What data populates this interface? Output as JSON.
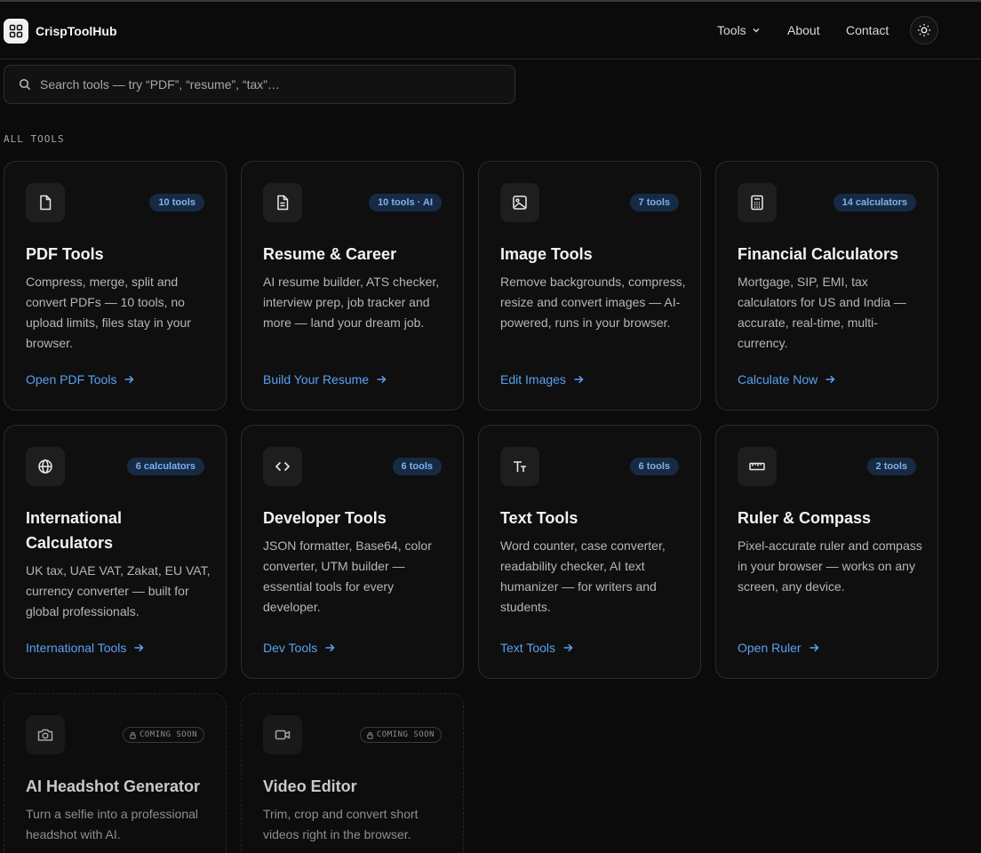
{
  "brand": {
    "name": "CrispToolHub"
  },
  "nav": {
    "tools": "Tools",
    "about": "About",
    "contact": "Contact"
  },
  "search": {
    "placeholder": "Search tools — try “PDF”, “resume”, “tax”…"
  },
  "section_label": "ALL TOOLS",
  "cards": [
    {
      "title": "PDF Tools",
      "badge": "10 tools",
      "icon": "file-icon",
      "desc": "Compress, merge, split and convert PDFs — 10 tools, no upload limits, files stay in your browser.",
      "link": "Open PDF Tools"
    },
    {
      "title": "Resume & Career",
      "badge": "10 tools · AI",
      "icon": "document-icon",
      "desc": "AI resume builder, ATS checker, interview prep, job tracker and more — land your dream job.",
      "link": "Build Your Resume"
    },
    {
      "title": "Image Tools",
      "badge": "7 tools",
      "icon": "image-icon",
      "desc": "Remove backgrounds, compress, resize and convert images — AI-powered, runs in your browser.",
      "link": "Edit Images"
    },
    {
      "title": "Financial Calculators",
      "badge": "14 calculators",
      "icon": "calculator-icon",
      "desc": "Mortgage, SIP, EMI, tax calculators for US and India — accurate, real-time, multi-currency.",
      "link": "Calculate Now"
    },
    {
      "title": "International Calculators",
      "badge": "6 calculators",
      "icon": "globe-icon",
      "desc": "UK tax, UAE VAT, Zakat, EU VAT, currency converter — built for global professionals.",
      "link": "International Tools"
    },
    {
      "title": "Developer Tools",
      "badge": "6 tools",
      "icon": "code-icon",
      "desc": "JSON formatter, Base64, color converter, UTM builder — essential tools for every developer.",
      "link": "Dev Tools"
    },
    {
      "title": "Text Tools",
      "badge": "6 tools",
      "icon": "text-icon",
      "desc": "Word counter, case converter, readability checker, AI text humanizer — for writers and students.",
      "link": "Text Tools"
    },
    {
      "title": "Ruler & Compass",
      "badge": "2 tools",
      "icon": "ruler-icon",
      "desc": "Pixel-accurate ruler and compass in your browser — works on any screen, any device.",
      "link": "Open Ruler"
    },
    {
      "title": "AI Headshot Generator",
      "badge": "COMING SOON",
      "icon": "camera-icon",
      "desc": "Turn a selfie into a professional headshot with AI."
    },
    {
      "title": "Video Editor",
      "badge": "COMING SOON",
      "icon": "video-icon",
      "desc": "Trim, crop and convert short videos right in the browser."
    }
  ]
}
